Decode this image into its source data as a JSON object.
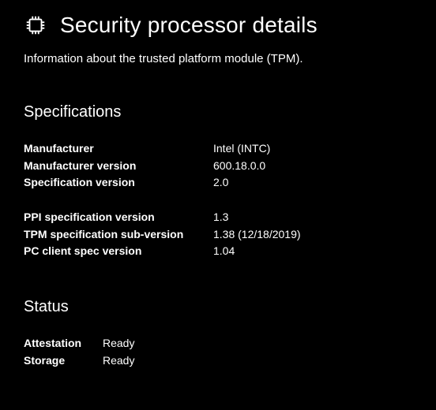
{
  "header": {
    "title": "Security processor details"
  },
  "description": "Information about the trusted platform module (TPM).",
  "specifications": {
    "heading": "Specifications",
    "group1": [
      {
        "label": "Manufacturer",
        "value": "Intel (INTC)"
      },
      {
        "label": "Manufacturer version",
        "value": "600.18.0.0"
      },
      {
        "label": "Specification version",
        "value": "2.0"
      }
    ],
    "group2": [
      {
        "label": "PPI specification version",
        "value": "1.3"
      },
      {
        "label": "TPM specification sub-version",
        "value": "1.38 (12/18/2019)"
      },
      {
        "label": "PC client spec version",
        "value": "1.04"
      }
    ]
  },
  "status": {
    "heading": "Status",
    "rows": [
      {
        "label": "Attestation",
        "value": "Ready"
      },
      {
        "label": "Storage",
        "value": "Ready"
      }
    ]
  }
}
